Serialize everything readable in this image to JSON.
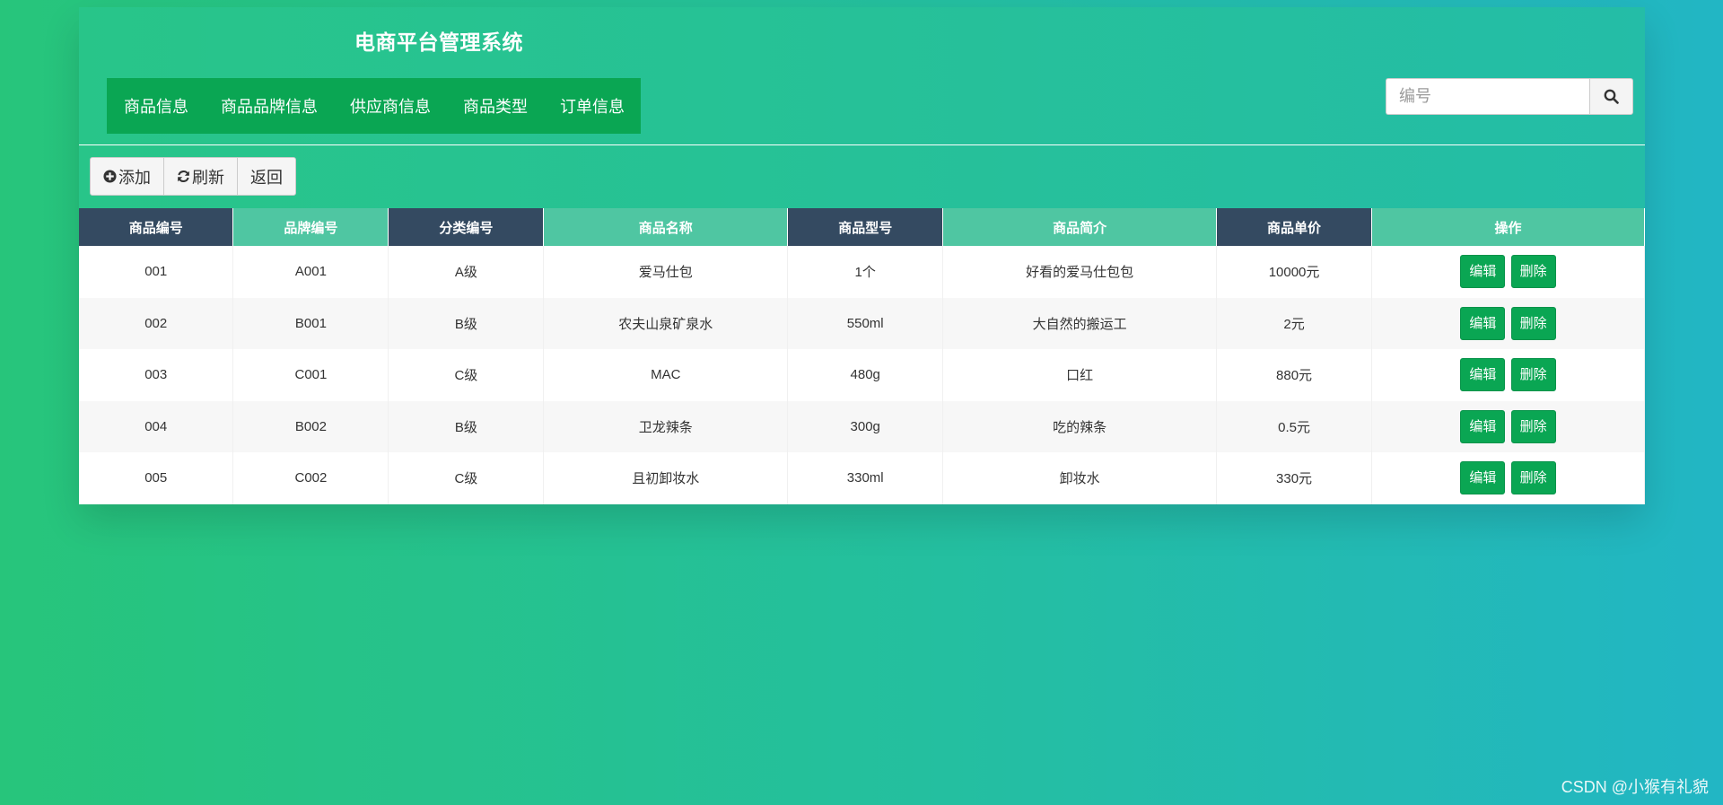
{
  "app": {
    "title": "电商平台管理系统"
  },
  "nav": {
    "items": [
      {
        "label": "商品信息"
      },
      {
        "label": "商品品牌信息"
      },
      {
        "label": "供应商信息"
      },
      {
        "label": "商品类型"
      },
      {
        "label": "订单信息"
      }
    ]
  },
  "search": {
    "placeholder": "编号",
    "value": "",
    "icon": "search-icon"
  },
  "toolbar": {
    "add_label": "添加",
    "refresh_label": "刷新",
    "back_label": "返回"
  },
  "table": {
    "columns": [
      "商品编号",
      "品牌编号",
      "分类编号",
      "商品名称",
      "商品型号",
      "商品简介",
      "商品单价",
      "操作"
    ],
    "rows": [
      {
        "id": "001",
        "brand": "A001",
        "category": "A级",
        "name": "爱马仕包",
        "model": "1个",
        "intro": "好看的爱马仕包包",
        "price": "10000元"
      },
      {
        "id": "002",
        "brand": "B001",
        "category": "B级",
        "name": "农夫山泉矿泉水",
        "model": "550ml",
        "intro": "大自然的搬运工",
        "price": "2元"
      },
      {
        "id": "003",
        "brand": "C001",
        "category": "C级",
        "name": "MAC",
        "model": "480g",
        "intro": "口红",
        "price": "880元"
      },
      {
        "id": "004",
        "brand": "B002",
        "category": "B级",
        "name": "卫龙辣条",
        "model": "300g",
        "intro": "吃的辣条",
        "price": "0.5元"
      },
      {
        "id": "005",
        "brand": "C002",
        "category": "C级",
        "name": "且初卸妆水",
        "model": "330ml",
        "intro": "卸妆水",
        "price": "330元"
      }
    ],
    "actions": {
      "edit_label": "编辑",
      "delete_label": "删除"
    }
  },
  "colors": {
    "nav_bg": "#0aa653",
    "header_dark": "#344a61",
    "header_light": "#4fc6a2",
    "action_btn": "#0aa653"
  },
  "watermark": "CSDN @小猴有礼貌"
}
